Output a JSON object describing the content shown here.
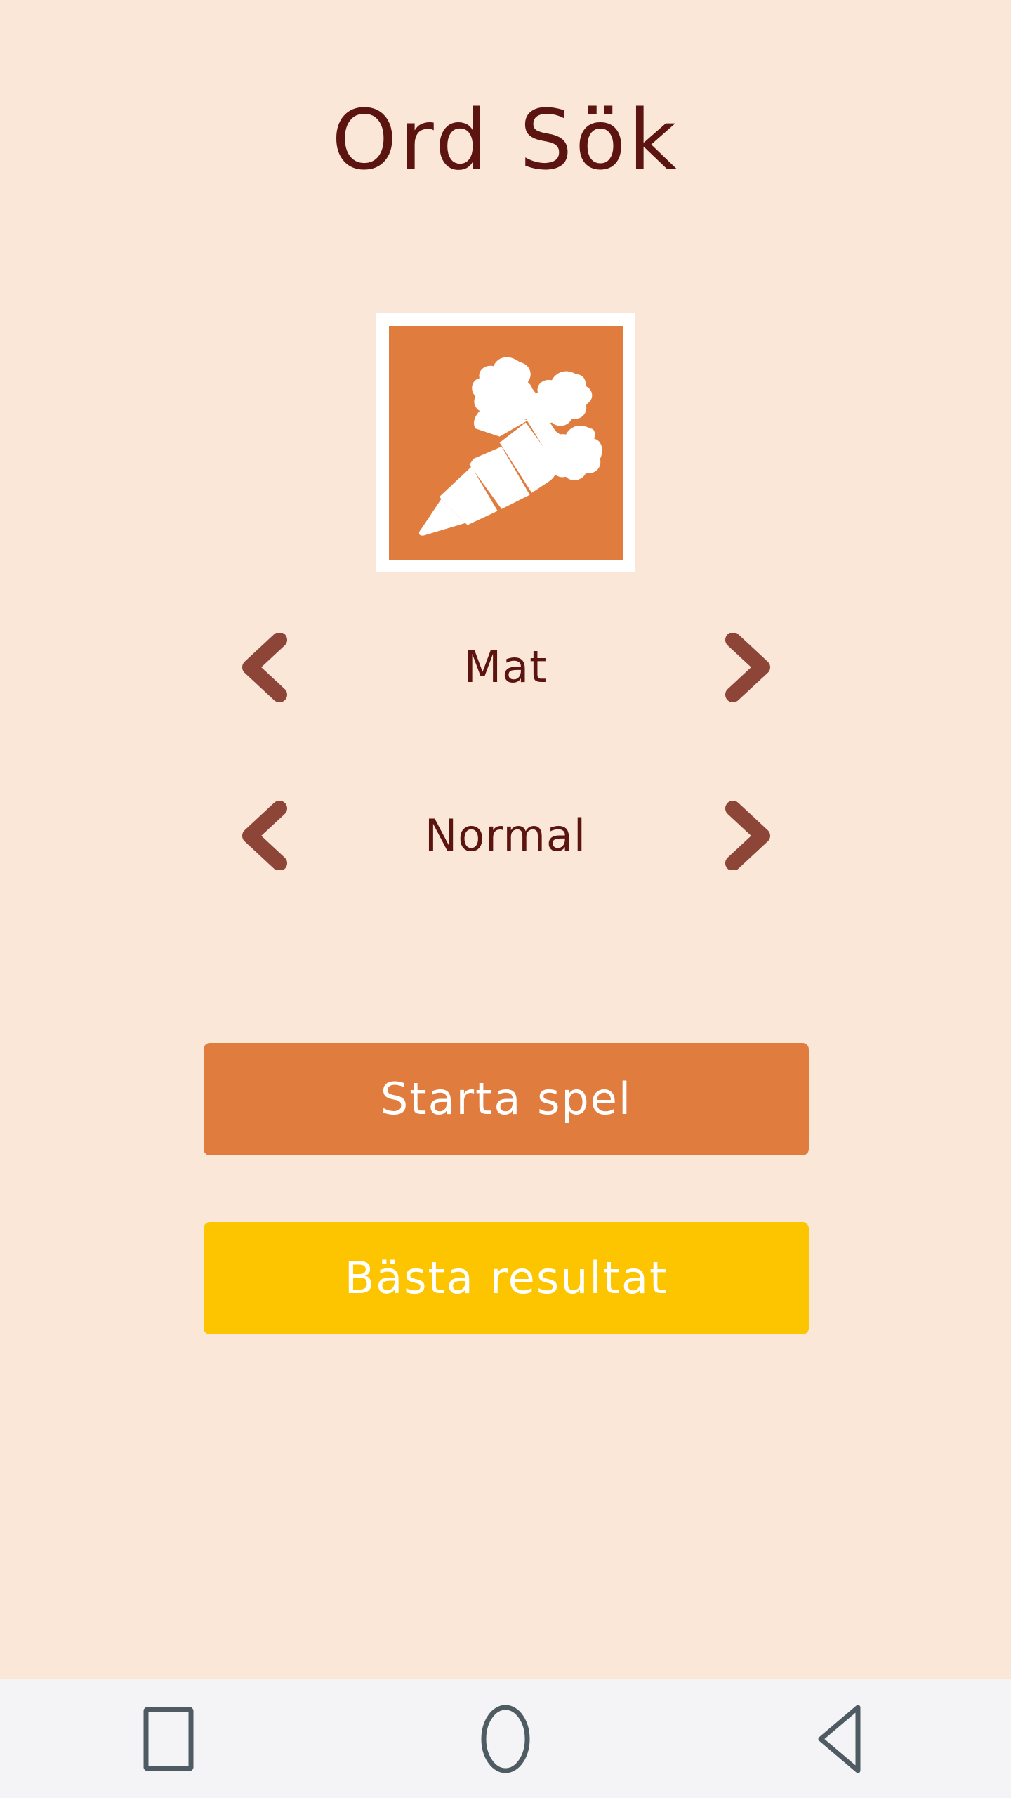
{
  "app": {
    "title": "Ord Sök",
    "background_color": "#FAE7D8",
    "title_color": "#5C1410"
  },
  "category_selector": {
    "name": "category",
    "value": "Mat",
    "icon": "carrot-icon",
    "icon_background_color": "#E07C3D",
    "icon_foreground_color": "#FFFFFF",
    "prev_icon": "chevron-left-icon",
    "next_icon": "chevron-right-icon",
    "arrow_color": "#8C4537"
  },
  "difficulty_selector": {
    "name": "difficulty",
    "value": "Normal",
    "prev_icon": "chevron-left-icon",
    "next_icon": "chevron-right-icon",
    "arrow_color": "#8C4537"
  },
  "buttons": {
    "start_game": {
      "label": "Starta spel",
      "background_color": "#E07C3D",
      "text_color": "#FFFFFF"
    },
    "high_scores": {
      "label": "Bästa resultat",
      "background_color": "#FDC500",
      "text_color": "#FFFFFF"
    }
  },
  "navigation_bar": {
    "background_color": "#F4F4F6",
    "icon_color": "#4F5B62",
    "items": [
      {
        "name": "recents-button",
        "icon": "square-icon"
      },
      {
        "name": "home-button",
        "icon": "circle-icon"
      },
      {
        "name": "back-button",
        "icon": "triangle-left-icon"
      }
    ]
  }
}
